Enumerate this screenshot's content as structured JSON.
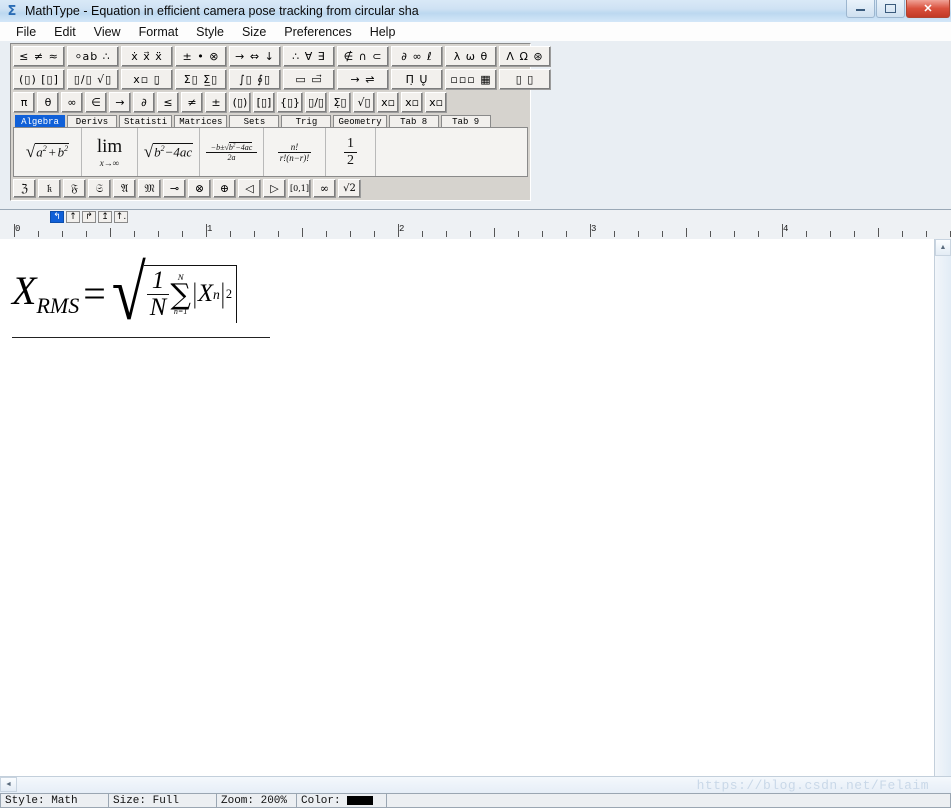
{
  "window": {
    "title": "MathType - Equation in efficient camera pose tracking from circular sha",
    "app_icon": "sigma-icon",
    "minimize_label": "Minimize",
    "maximize_label": "Maximize",
    "close_label": "✕"
  },
  "menu": {
    "items": [
      {
        "label": "File",
        "accel": "F"
      },
      {
        "label": "Edit",
        "accel": "E"
      },
      {
        "label": "View",
        "accel": "V"
      },
      {
        "label": "Format",
        "accel": "o"
      },
      {
        "label": "Style",
        "accel": "S"
      },
      {
        "label": "Size",
        "accel": "z"
      },
      {
        "label": "Preferences",
        "accel": "P"
      },
      {
        "label": "Help",
        "accel": "H"
      }
    ]
  },
  "symbol_palette": {
    "row1": [
      {
        "name": "relations-palette",
        "glyph": "≤ ≠ ≈"
      },
      {
        "name": "spaces-dots-palette",
        "glyph": "⸰ab ∴"
      },
      {
        "name": "embellishments-palette",
        "glyph": "ẋ x⃗ ẍ"
      },
      {
        "name": "operators-palette",
        "glyph": "± • ⊗"
      },
      {
        "name": "arrows-palette",
        "glyph": "→ ⇔ ↓"
      },
      {
        "name": "logic-palette",
        "glyph": "∴ ∀ ∃"
      },
      {
        "name": "set-theory-palette",
        "glyph": "∉ ∩ ⊂"
      },
      {
        "name": "misc-symbols-palette",
        "glyph": "∂ ∞ ℓ"
      },
      {
        "name": "greek-lowercase-palette",
        "glyph": "λ ω θ"
      },
      {
        "name": "greek-uppercase-palette",
        "glyph": "Λ Ω ⊛"
      }
    ],
    "row2": [
      {
        "name": "fences-template",
        "glyph": "(▯) [▯]"
      },
      {
        "name": "fraction-radical-template",
        "glyph": "▯/▯ √▯"
      },
      {
        "name": "subscript-superscript-template",
        "glyph": "x▫ ▯̣"
      },
      {
        "name": "summation-template",
        "glyph": "Σ▯ Σ̲▯"
      },
      {
        "name": "integral-template",
        "glyph": "∫▯ ∮▯"
      },
      {
        "name": "underbar-overbar-template",
        "glyph": "▭ ▭⃗"
      },
      {
        "name": "labeled-arrow-template",
        "glyph": "→ ⇌"
      },
      {
        "name": "product-set-template",
        "glyph": "Π̣ U̥"
      },
      {
        "name": "matrix-template",
        "glyph": "▫▫▫ ▦"
      },
      {
        "name": "array-template",
        "glyph": "▯ ▯"
      }
    ],
    "row3": [
      {
        "name": "pi-symbol",
        "glyph": "π"
      },
      {
        "name": "theta-symbol",
        "glyph": "θ"
      },
      {
        "name": "infinity-symbol",
        "glyph": "∞"
      },
      {
        "name": "element-of-symbol",
        "glyph": "∈"
      },
      {
        "name": "right-arrow-symbol",
        "glyph": "→"
      },
      {
        "name": "partial-derivative-symbol",
        "glyph": "∂"
      },
      {
        "name": "less-than-equal-symbol",
        "glyph": "≤"
      },
      {
        "name": "not-equal-symbol",
        "glyph": "≠"
      },
      {
        "name": "plus-minus-symbol",
        "glyph": "±"
      },
      {
        "name": "parenthesis-template",
        "glyph": "(▯)"
      },
      {
        "name": "bracket-template",
        "glyph": "[▯]"
      },
      {
        "name": "brace-template",
        "glyph": "{▯}"
      },
      {
        "name": "fraction-template",
        "glyph": "▯/▯"
      },
      {
        "name": "summation-template-2",
        "glyph": "Σ̣▯"
      },
      {
        "name": "radical-template",
        "glyph": "√▯"
      },
      {
        "name": "superscript-template",
        "glyph": "x▫"
      },
      {
        "name": "subscript-template",
        "glyph": "x▫"
      },
      {
        "name": "sub-sup-template",
        "glyph": "x▫"
      }
    ]
  },
  "tabs": {
    "items": [
      {
        "label": "Algebra",
        "active": true
      },
      {
        "label": "Derivs",
        "active": false
      },
      {
        "label": "Statisti",
        "active": false
      },
      {
        "label": "Matrices",
        "active": false
      },
      {
        "label": "Sets",
        "active": false
      },
      {
        "label": "Trig",
        "active": false
      },
      {
        "label": "Geometry",
        "active": false
      },
      {
        "label": "Tab 8",
        "active": false
      },
      {
        "label": "Tab 9",
        "active": false
      }
    ]
  },
  "templates": {
    "items": [
      {
        "name": "sqrt-a2-plus-b2",
        "expr": "√(a²+b²)"
      },
      {
        "name": "limit-x-to-infinity",
        "expr": "lim x→∞"
      },
      {
        "name": "sqrt-discriminant",
        "expr": "√(b²−4ac)"
      },
      {
        "name": "quadratic-formula",
        "expr": "(−b±√(b²−4ac))/2a"
      },
      {
        "name": "combinations-formula",
        "expr": "n!/(r!(n−r)!)"
      },
      {
        "name": "one-half-fraction",
        "expr": "1/2"
      }
    ]
  },
  "symbol_row": {
    "items": [
      {
        "name": "fraktur-z-symbol",
        "glyph": "ℨ"
      },
      {
        "name": "fraktur-k-symbol",
        "glyph": "𝔨"
      },
      {
        "name": "fraktur-f-symbol",
        "glyph": "𝔉"
      },
      {
        "name": "fraktur-s-symbol",
        "glyph": "𝔖"
      },
      {
        "name": "fraktur-a-symbol",
        "glyph": "𝔄"
      },
      {
        "name": "fraktur-m-symbol",
        "glyph": "𝔐"
      },
      {
        "name": "maps-to-symbol",
        "glyph": "⊸"
      },
      {
        "name": "circled-times-symbol",
        "glyph": "⊗"
      },
      {
        "name": "circled-plus-symbol",
        "glyph": "⊕"
      },
      {
        "name": "left-triangle-symbol",
        "glyph": "◁"
      },
      {
        "name": "right-triangle-symbol",
        "glyph": "▷"
      },
      {
        "name": "unit-interval-symbol",
        "glyph": "[0,1]"
      },
      {
        "name": "infinity-symbol-2",
        "glyph": "∞"
      },
      {
        "name": "sqrt-two-symbol",
        "glyph": "√2"
      }
    ]
  },
  "tabstops": {
    "buttons": [
      {
        "name": "tab-align-left",
        "glyph": "↰",
        "active": true
      },
      {
        "name": "tab-align-center",
        "glyph": "↑",
        "active": false
      },
      {
        "name": "tab-align-right",
        "glyph": "↱",
        "active": false
      },
      {
        "name": "tab-align-decimal",
        "glyph": "↥",
        "active": false
      },
      {
        "name": "tab-align-relation",
        "glyph": "↑.",
        "active": false
      }
    ]
  },
  "ruler": {
    "labels": [
      "0",
      "1",
      "2",
      "3",
      "4"
    ]
  },
  "equation": {
    "lhs_var": "X",
    "lhs_sub": "RMS",
    "equals": "=",
    "radical_glyph": "√",
    "frac_numerator": "1",
    "frac_denominator": "N",
    "sum_upper": "N",
    "sum_glyph": "∑",
    "sum_lower": "n=1",
    "abs_open": "|",
    "abs_var": "X",
    "abs_sub": "n",
    "abs_close": "|",
    "exponent": "2",
    "plain_text": "X_RMS = sqrt( (1/N) * sum_{n=1}^{N} |X_n|^2 )"
  },
  "statusbar": {
    "style_label": "Style: Math",
    "size_label": "Size: Full",
    "zoom_label": "Zoom: 200%",
    "color_label": "Color:",
    "color_value": "#000000"
  },
  "watermark": {
    "text": "https://blog.csdn.net/Felaim"
  },
  "scroll": {
    "v_up_glyph": "▲",
    "h_left_glyph": "◄"
  }
}
